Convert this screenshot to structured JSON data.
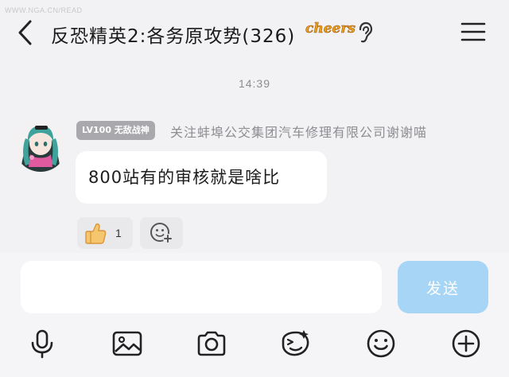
{
  "watermark": "WWW.NGA.CN/READ",
  "header": {
    "title": "反恐精英2:各务原攻势(326)",
    "sticker_text": "cheers",
    "icons": [
      "back-arrow-icon",
      "ear-icon",
      "menu-icon"
    ]
  },
  "chat": {
    "timestamp": "14:39",
    "message": {
      "level_badge": "LV100 无敌战神",
      "sender_name": "关注蚌埠公交集团汽车修理有限公司谢谢喵",
      "text": "800站有的审核就是啥比",
      "reactions": [
        {
          "icon": "thumbs-up-icon",
          "count": "1"
        }
      ],
      "add_reaction_icon": "add-emoji-icon"
    }
  },
  "composer": {
    "input_value": "",
    "input_placeholder": "",
    "send_label": "发送",
    "toolbar": [
      {
        "name": "microphone-icon"
      },
      {
        "name": "image-icon"
      },
      {
        "name": "camera-icon"
      },
      {
        "name": "sticker-icon"
      },
      {
        "name": "emoji-icon"
      },
      {
        "name": "plus-icon"
      }
    ]
  },
  "colors": {
    "background": "#f2f2f4",
    "bubble": "#ffffff",
    "send_button": "#a6d5f6",
    "badge": "#a9a9ad",
    "sticker": "#e8a21a"
  }
}
